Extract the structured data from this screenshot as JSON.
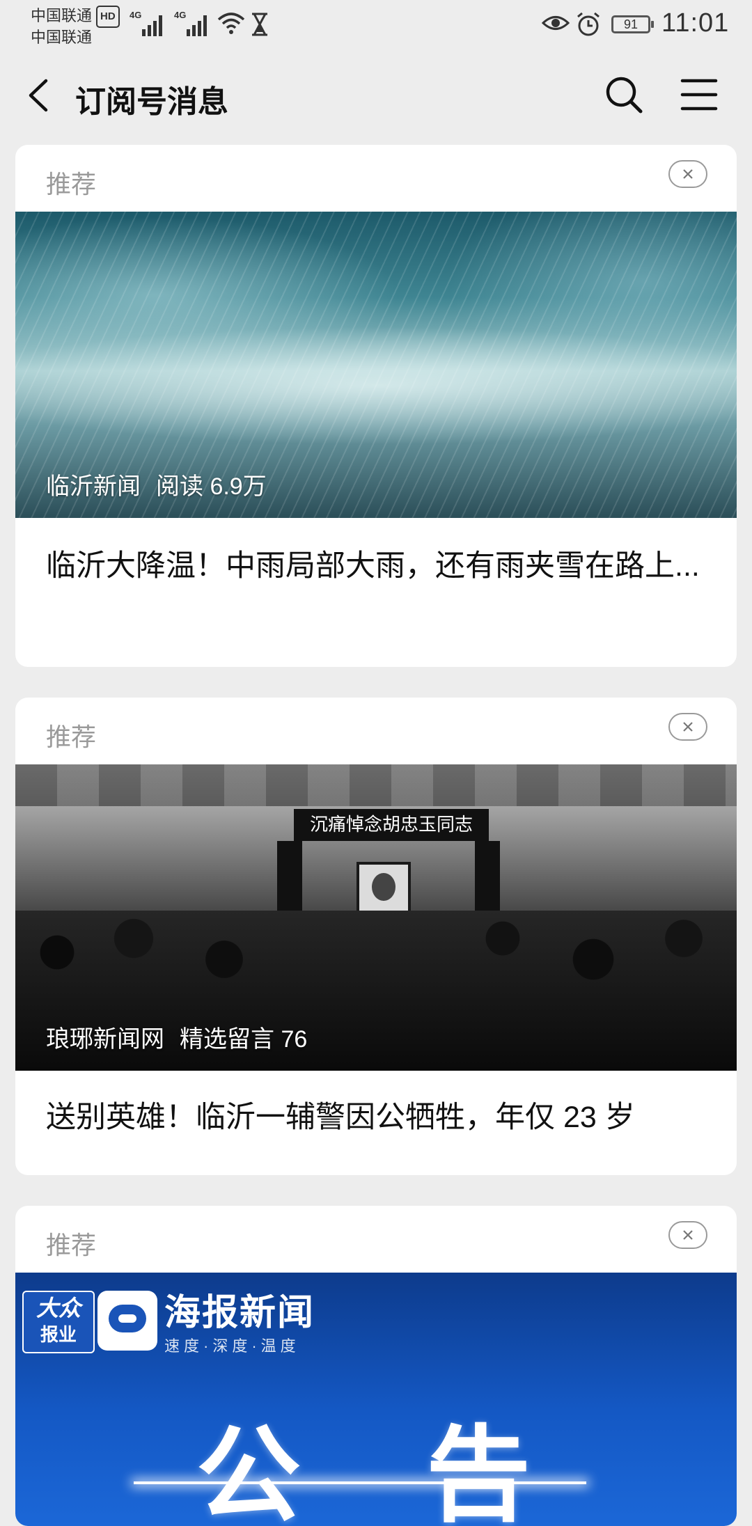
{
  "status_bar": {
    "carrier1": "中国联通",
    "carrier2": "中国联通",
    "hd": "HD",
    "net1": "4G",
    "net2": "4G",
    "battery": "91",
    "time": "11:01"
  },
  "header": {
    "title": "订阅号消息"
  },
  "feed": [
    {
      "label": "推荐",
      "source": "临沂新闻",
      "stat": "阅读 6.9万",
      "headline": "临沂大降温！中雨局部大雨，还有雨夹雪在路上..."
    },
    {
      "label": "推荐",
      "source": "琅琊新闻网",
      "stat": "精选留言 76",
      "headline": "送别英雄！临沂一辅警因公牺牲，年仅 23 岁",
      "image_banner": "沉痛悼念胡忠玉同志"
    },
    {
      "label": "推荐",
      "logo_left_1": "大众",
      "logo_left_2": "报业",
      "brand_name": "海报新闻",
      "brand_slogan": "速度·深度·温度",
      "notice": "公告"
    }
  ],
  "colors": {
    "background": "#ededed",
    "card": "#ffffff",
    "label_gray": "#9a9a9a"
  },
  "icons": [
    "back-arrow-icon",
    "search-icon",
    "menu-icon",
    "close-icon",
    "wifi-icon",
    "hourglass-icon",
    "eye-icon",
    "alarm-icon",
    "battery-icon"
  ]
}
